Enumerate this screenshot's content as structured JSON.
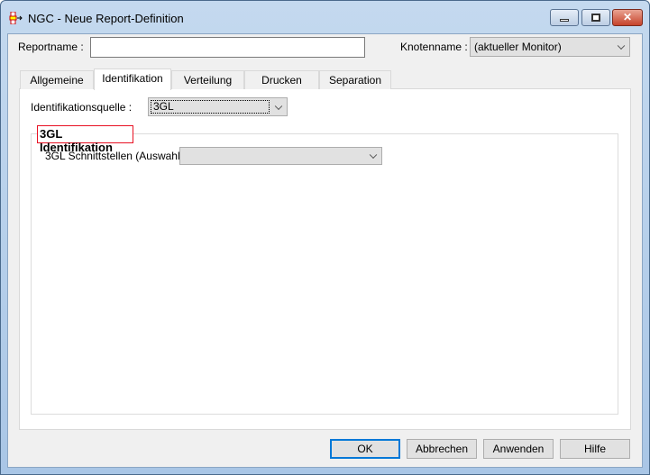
{
  "window": {
    "title": "NGC - Neue Report-Definition",
    "icon": "report-definition-icon"
  },
  "form": {
    "reportname_label": "Reportname :",
    "reportname_value": "",
    "knotenname_label": "Knotenname :",
    "knotenname_value": "(aktueller Monitor)"
  },
  "tabs": [
    {
      "label": "Allgemeine"
    },
    {
      "label": "Identifikation",
      "selected": true
    },
    {
      "label": "Verteilung"
    },
    {
      "label": "Drucken"
    },
    {
      "label": "Separation"
    }
  ],
  "identifikation": {
    "quelle_label": "Identifikationsquelle :",
    "quelle_value": "3GL",
    "group_title": "3GL Identifikation",
    "schnittstellen_label": "3GL Schnittstellen (Auswahl) :",
    "schnittstellen_value": ""
  },
  "buttons": {
    "ok": "OK",
    "cancel": "Abbrechen",
    "apply": "Anwenden",
    "help": "Hilfe"
  },
  "colors": {
    "highlight": "#e81123",
    "default_button": "#0078d7"
  }
}
